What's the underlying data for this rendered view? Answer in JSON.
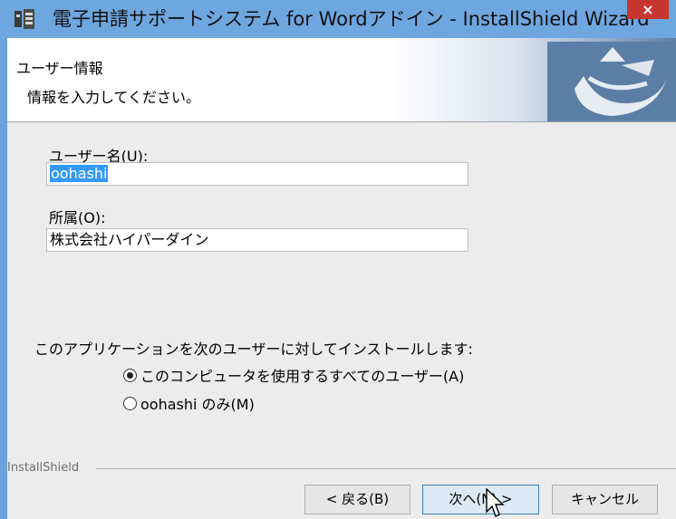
{
  "window": {
    "title": "電子申請サポートシステム for Wordアドイン - InstallShield Wizard",
    "close_glyph": "×"
  },
  "header": {
    "title": "ユーザー情報",
    "subtitle": "情報を入力してください。"
  },
  "form": {
    "username_label": "ユーザー名(U):",
    "username_value": "oohashi",
    "organization_label": "所属(O):",
    "organization_value": "株式会社ハイパーダイン"
  },
  "install_for": {
    "prompt": "このアプリケーションを次のユーザーに対してインストールします:",
    "options": [
      {
        "label": "このコンピュータを使用するすべてのユーザー(A)",
        "selected": true
      },
      {
        "label": "oohashi のみ(M)",
        "selected": false
      }
    ]
  },
  "footer": {
    "brand": "InstallShield",
    "back_label": "< 戻る(B)",
    "next_label": "次へ(N) >",
    "cancel_label": "キャンセル"
  },
  "colors": {
    "titlebar": "#6ea6e0",
    "close": "#c7372f",
    "selection": "#3399ff"
  }
}
